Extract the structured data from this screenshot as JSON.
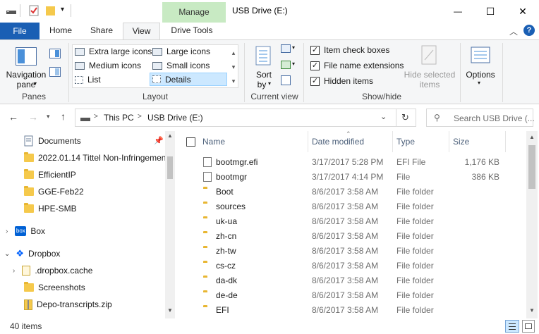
{
  "window": {
    "title": "USB Drive (E:)",
    "manage_tab": "Manage",
    "minimize_glyph": "—",
    "maximize_glyph": "☐",
    "close_glyph": "✕"
  },
  "ribbon_tabs": {
    "file": "File",
    "home": "Home",
    "share": "Share",
    "view": "View",
    "drive_tools": "Drive Tools"
  },
  "ribbon": {
    "panes": {
      "nav_pane_line1": "Navigation",
      "nav_pane_line2": "pane",
      "group_label": "Panes"
    },
    "layout": {
      "extra_large_icons": "Extra large icons",
      "large_icons": "Large icons",
      "medium_icons": "Medium icons",
      "small_icons": "Small icons",
      "list": "List",
      "details": "Details",
      "group_label": "Layout"
    },
    "current_view": {
      "sort_line1": "Sort",
      "sort_line2": "by",
      "group_label": "Current view"
    },
    "show_hide": {
      "item_check_boxes": "Item check boxes",
      "file_name_extensions": "File name extensions",
      "hidden_items": "Hidden items",
      "hide_selected_line1": "Hide selected",
      "hide_selected_line2": "items",
      "group_label": "Show/hide"
    },
    "options": {
      "label": "Options"
    }
  },
  "address": {
    "crumbs": [
      "This PC",
      "USB Drive (E:)"
    ],
    "separator": ">",
    "search_placeholder": "Search USB Drive (..."
  },
  "nav_pane": {
    "items": [
      {
        "label": "Documents"
      },
      {
        "label": "2022.01.14 Tittel Non-Infringemen"
      },
      {
        "label": "EfficientIP"
      },
      {
        "label": "GGE-Feb22"
      },
      {
        "label": "HPE-SMB"
      },
      {
        "label": "Box"
      },
      {
        "label": "Dropbox"
      },
      {
        "label": ".dropbox.cache"
      },
      {
        "label": "Screenshots"
      },
      {
        "label": "Depo-transcripts.zip"
      }
    ],
    "box_badge": "box"
  },
  "file_list": {
    "columns": {
      "name": "Name",
      "date_modified": "Date modified",
      "type": "Type",
      "size": "Size"
    },
    "rows": [
      {
        "name": "bootmgr.efi",
        "date": "3/17/2017 5:28 PM",
        "type": "EFI File",
        "size": "1,176 KB"
      },
      {
        "name": "bootmgr",
        "date": "3/17/2017 4:14 PM",
        "type": "File",
        "size": "386 KB"
      },
      {
        "name": "Boot",
        "date": "8/6/2017 3:58 AM",
        "type": "File folder",
        "size": ""
      },
      {
        "name": "sources",
        "date": "8/6/2017 3:58 AM",
        "type": "File folder",
        "size": ""
      },
      {
        "name": "uk-ua",
        "date": "8/6/2017 3:58 AM",
        "type": "File folder",
        "size": ""
      },
      {
        "name": "zh-cn",
        "date": "8/6/2017 3:58 AM",
        "type": "File folder",
        "size": ""
      },
      {
        "name": "zh-tw",
        "date": "8/6/2017 3:58 AM",
        "type": "File folder",
        "size": ""
      },
      {
        "name": "cs-cz",
        "date": "8/6/2017 3:58 AM",
        "type": "File folder",
        "size": ""
      },
      {
        "name": "da-dk",
        "date": "8/6/2017 3:58 AM",
        "type": "File folder",
        "size": ""
      },
      {
        "name": "de-de",
        "date": "8/6/2017 3:58 AM",
        "type": "File folder",
        "size": ""
      },
      {
        "name": "EFI",
        "date": "8/6/2017 3:58 AM",
        "type": "File folder",
        "size": ""
      }
    ]
  },
  "status": {
    "item_count": "40 items"
  },
  "colors": {
    "accent": "#1a5fb4",
    "manage_tab_bg": "#c8eac3",
    "folder": "#f5c94c",
    "details_selected": "#cce8ff"
  }
}
